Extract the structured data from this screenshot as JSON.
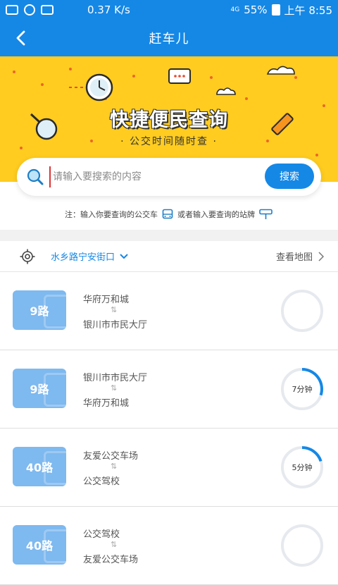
{
  "status_bar": {
    "speed": "0.37 K/s",
    "network": "4G",
    "battery": "55%",
    "time": "上午 8:55"
  },
  "header": {
    "title": "赶车儿"
  },
  "banner": {
    "title": "快捷便民查询",
    "subtitle": "公交时间随时查"
  },
  "search": {
    "placeholder": "请输入要搜索的内容",
    "button_label": "搜索"
  },
  "hint": {
    "part1": "注：输入你要查询的公交车",
    "part2": "或者输入要查询的站牌"
  },
  "location": {
    "name": "水乡路宁安街口",
    "map_link": "查看地图"
  },
  "routes": [
    {
      "number": "9路",
      "from": "华府万和城",
      "to": "银川市市民大厅",
      "eta": "",
      "progress": 0
    },
    {
      "number": "9路",
      "from": "银川市市民大厅",
      "to": "华府万和城",
      "eta": "7分钟",
      "progress": 0.3
    },
    {
      "number": "40路",
      "from": "友爱公交车场",
      "to": "公交驾校",
      "eta": "5分钟",
      "progress": 0.2
    },
    {
      "number": "40路",
      "from": "公交驾校",
      "to": "友爱公交车场",
      "eta": "",
      "progress": 0
    }
  ],
  "colors": {
    "primary": "#1588e6",
    "banner_bg": "#ffcc1f",
    "badge": "#7eb9ef",
    "ring_track": "#e6e9ee"
  },
  "icons": {
    "swap": "⇅"
  }
}
